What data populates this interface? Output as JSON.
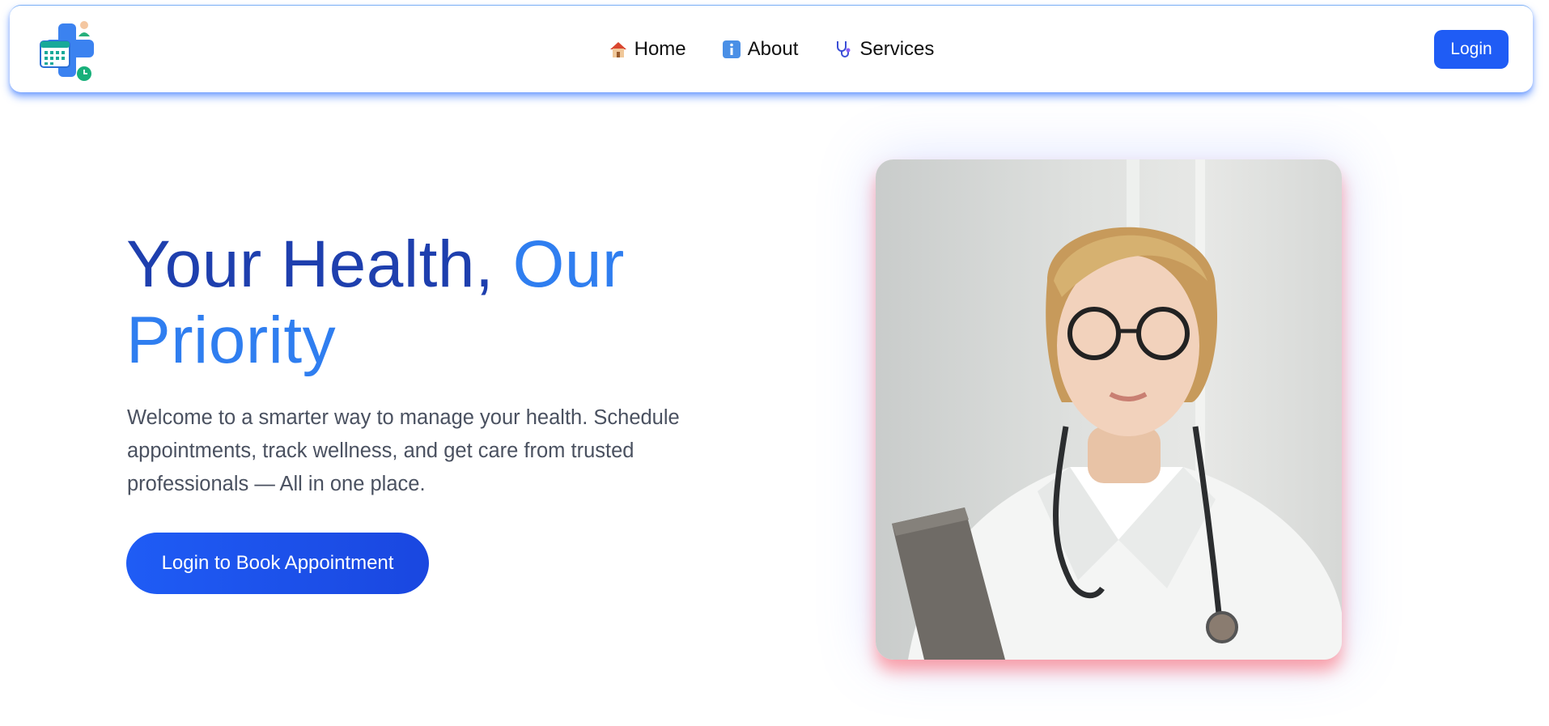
{
  "header": {
    "logo_name": "calendar-medical-cross-logo",
    "nav": [
      {
        "label": "Home",
        "icon": "house-icon"
      },
      {
        "label": "About",
        "icon": "info-icon"
      },
      {
        "label": "Services",
        "icon": "stethoscope-icon"
      }
    ],
    "login_label": "Login"
  },
  "hero": {
    "title_part1": "Your Health, ",
    "title_part2": "Our Priority",
    "description": "Welcome to a smarter way to manage your health. Schedule appointments, track wellness, and get care from trusted professionals — All in one place.",
    "cta_label": "Login to Book Appointment",
    "image_subject": "doctor-photo"
  },
  "colors": {
    "primary": "#1f5cf5",
    "title_dark": "#1e3fae",
    "title_accent": "#2f7ef0",
    "text": "#4a5160",
    "glow": "#ff5a64"
  }
}
